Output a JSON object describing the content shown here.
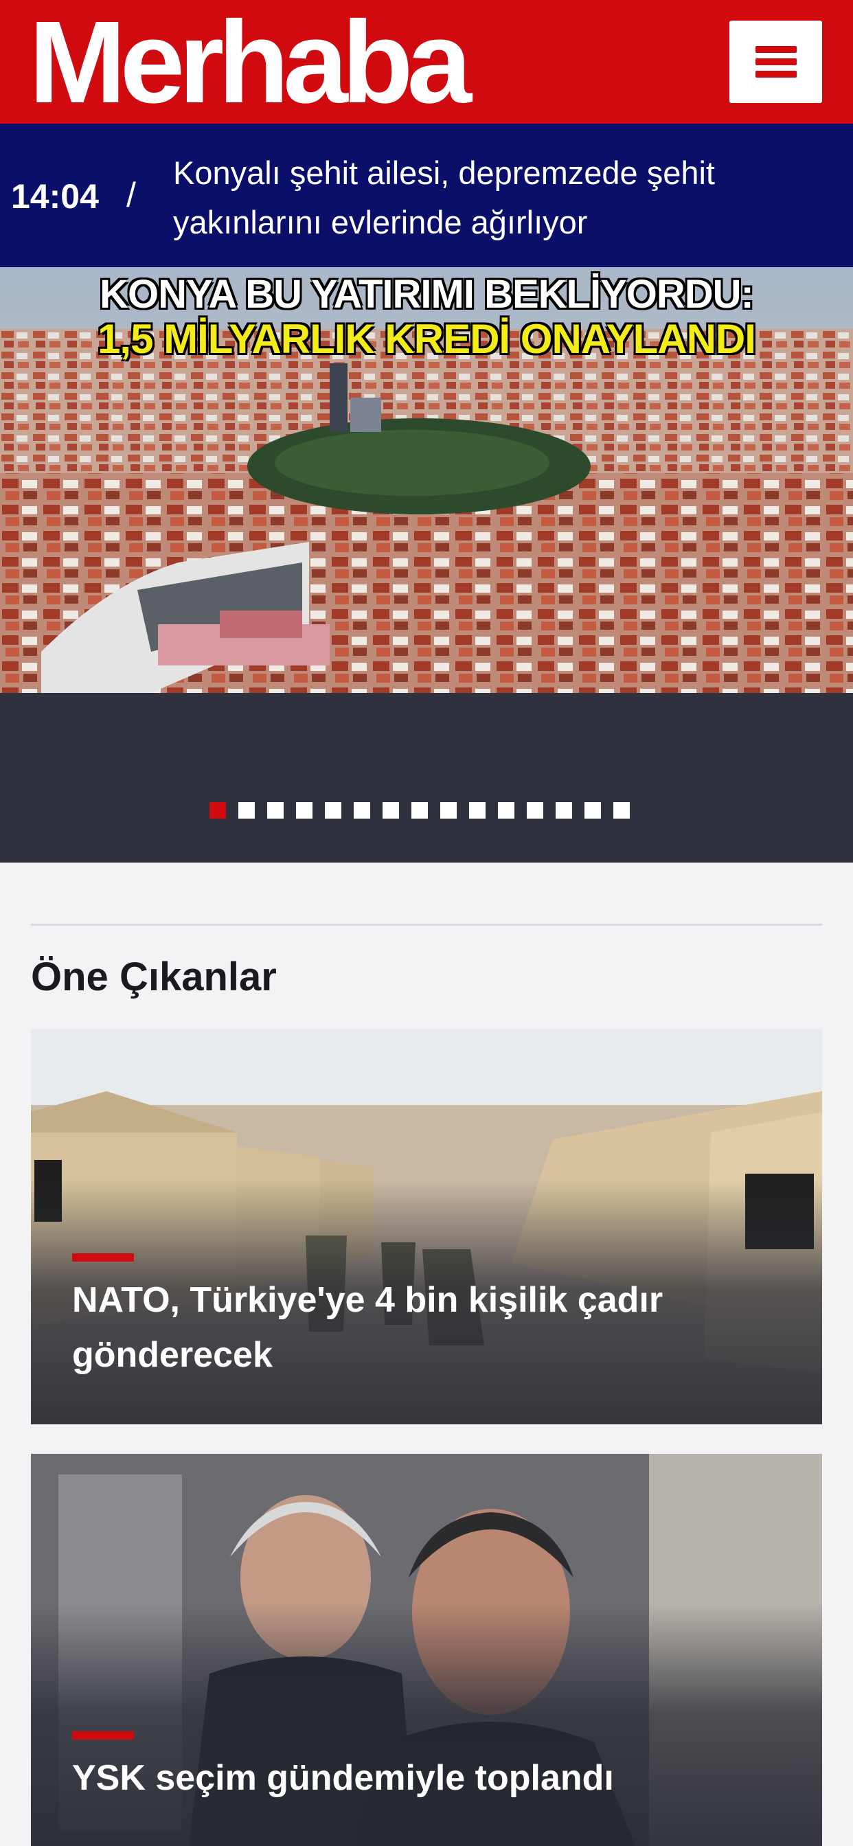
{
  "header": {
    "logo_text": "Merhaba",
    "menu_icon": "hamburger-menu-icon",
    "brand_color": "#d10a0f"
  },
  "ticker": {
    "time": "14:04",
    "separator": "/",
    "headline": "Konyalı şehit ailesi, depremzede şehit yakınlarını evlerinde ağırlıyor",
    "background": "#0a0f6a"
  },
  "hero": {
    "caption_line1": "KONYA BU YATIRIMI BEKLİYORDU:",
    "caption_line2": "1,5 MİLYARLIK KREDİ ONAYLANDI",
    "slide_count": 15,
    "active_slide": 1
  },
  "featured": {
    "title_light": "Öne",
    "title_bold": "Çıkanlar",
    "cards": [
      {
        "title": "NATO, Türkiye'ye 4 bin kişilik çadır gönderecek"
      },
      {
        "title": "YSK seçim gündemiyle toplandı"
      }
    ]
  }
}
